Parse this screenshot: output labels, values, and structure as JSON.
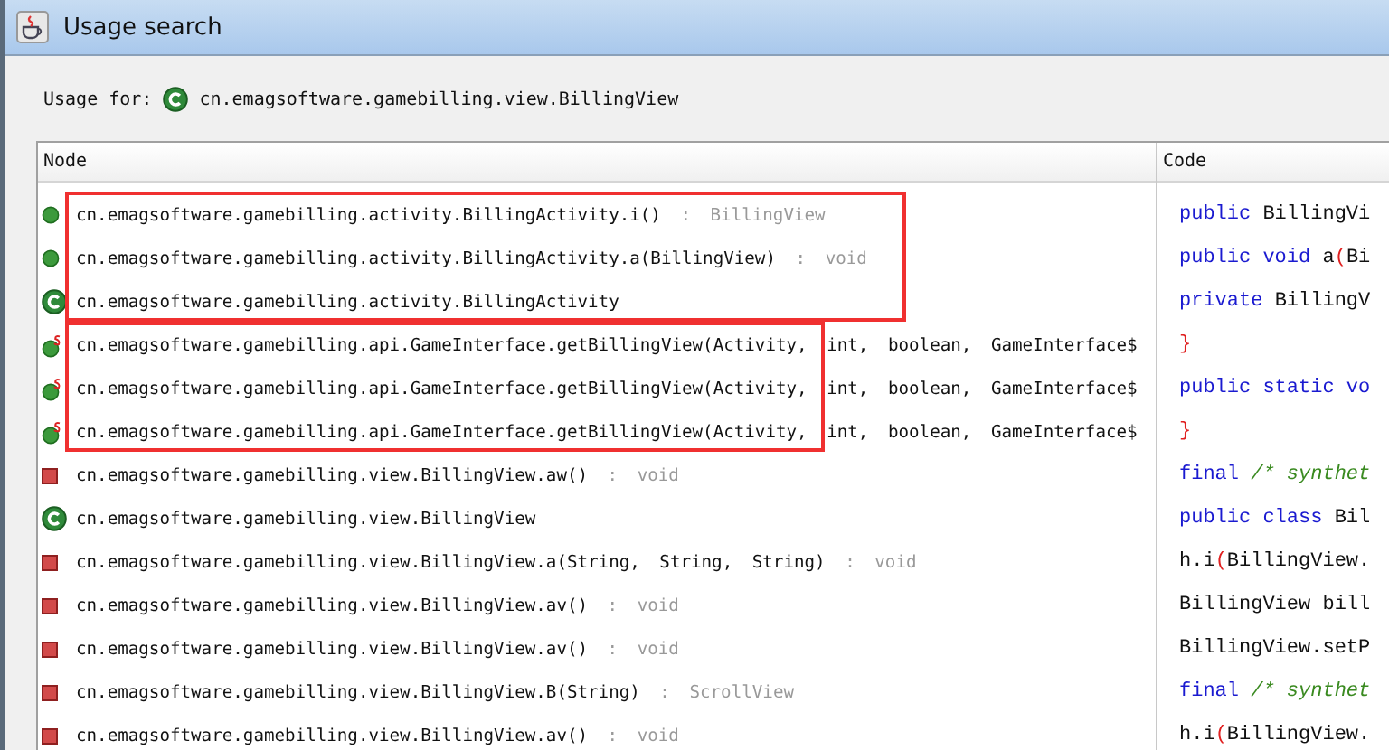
{
  "window": {
    "title": "Usage search"
  },
  "usage_for": {
    "label": "Usage for:",
    "kind": "class",
    "target": "cn.emagsoftware.gamebilling.view.BillingView"
  },
  "table": {
    "columns": [
      "Node",
      "Code"
    ],
    "groups": [
      {
        "highlighted": true,
        "rows": [
          {
            "kind": "method",
            "name": "cn.emagsoftware.gamebilling.activity.BillingActivity.i()",
            "type": " : BillingView"
          },
          {
            "kind": "method",
            "name": "cn.emagsoftware.gamebilling.activity.BillingActivity.a(BillingView)",
            "type": " : void"
          },
          {
            "kind": "class",
            "name": "cn.emagsoftware.gamebilling.activity.BillingActivity"
          }
        ]
      },
      {
        "highlighted": true,
        "rows": [
          {
            "kind": "static_method",
            "name": "cn.emagsoftware.gamebilling.api.GameInterface.getBillingView(Activity, int, boolean, GameInterface$"
          },
          {
            "kind": "static_method",
            "name": "cn.emagsoftware.gamebilling.api.GameInterface.getBillingView(Activity, int, boolean, GameInterface$"
          },
          {
            "kind": "static_method",
            "name": "cn.emagsoftware.gamebilling.api.GameInterface.getBillingView(Activity, int, boolean, GameInterface$"
          }
        ]
      },
      {
        "highlighted": false,
        "rows": [
          {
            "kind": "private_method",
            "name": "cn.emagsoftware.gamebilling.view.BillingView.aw()",
            "type": " : void"
          },
          {
            "kind": "class",
            "name": "cn.emagsoftware.gamebilling.view.BillingView"
          },
          {
            "kind": "private_method",
            "name": "cn.emagsoftware.gamebilling.view.BillingView.a(String, String, String)",
            "type": " : void"
          },
          {
            "kind": "private_method",
            "name": "cn.emagsoftware.gamebilling.view.BillingView.av()",
            "type": " : void"
          },
          {
            "kind": "private_method",
            "name": "cn.emagsoftware.gamebilling.view.BillingView.av()",
            "type": " : void"
          },
          {
            "kind": "private_method",
            "name": "cn.emagsoftware.gamebilling.view.BillingView.B(String)",
            "type": " : ScrollView"
          },
          {
            "kind": "private_method",
            "name": "cn.emagsoftware.gamebilling.view.BillingView.av()",
            "type": " : void"
          }
        ]
      }
    ],
    "code_lines": [
      [
        {
          "kind": "keyword",
          "text": "public"
        },
        {
          "kind": "plain",
          "text": " BillingVi"
        }
      ],
      [
        {
          "kind": "keyword",
          "text": "public void"
        },
        {
          "kind": "plain",
          "text": " a"
        },
        {
          "kind": "paren",
          "text": "("
        },
        {
          "kind": "plain",
          "text": "Bi"
        }
      ],
      [
        {
          "kind": "keyword",
          "text": "private"
        },
        {
          "kind": "plain",
          "text": " BillingV"
        }
      ],
      [
        {
          "kind": "paren",
          "text": "}"
        }
      ],
      [
        {
          "kind": "keyword",
          "text": "public static vo"
        }
      ],
      [
        {
          "kind": "paren",
          "text": "}"
        }
      ],
      [
        {
          "kind": "keyword",
          "text": "final"
        },
        {
          "kind": "comment",
          "text": " /* synthet"
        }
      ],
      [
        {
          "kind": "keyword",
          "text": "public class"
        },
        {
          "kind": "plain",
          "text": " Bil"
        }
      ],
      [
        {
          "kind": "plain",
          "text": "h.i"
        },
        {
          "kind": "paren",
          "text": "("
        },
        {
          "kind": "plain",
          "text": "BillingView."
        }
      ],
      [
        {
          "kind": "plain",
          "text": "BillingView bill"
        }
      ],
      [
        {
          "kind": "plain",
          "text": "BillingView.setP"
        }
      ],
      [
        {
          "kind": "keyword",
          "text": "final"
        },
        {
          "kind": "comment",
          "text": " /* synthet"
        }
      ],
      [
        {
          "kind": "plain",
          "text": "h.i"
        },
        {
          "kind": "paren",
          "text": "("
        },
        {
          "kind": "plain",
          "text": "BillingView."
        }
      ]
    ]
  }
}
